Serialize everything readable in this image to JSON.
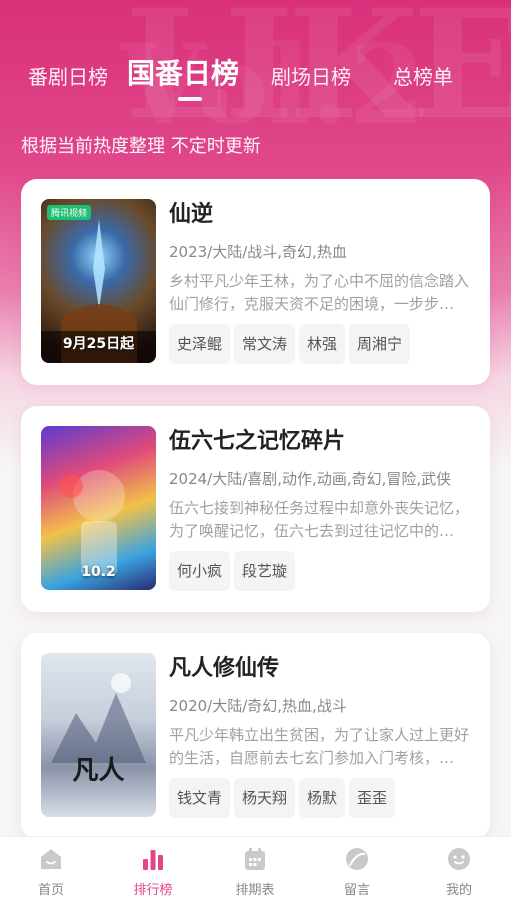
{
  "tabs": [
    {
      "label": "番剧日榜"
    },
    {
      "label": "国番日榜"
    },
    {
      "label": "剧场日榜"
    },
    {
      "label": "总榜单"
    }
  ],
  "active_tab": 1,
  "subtitle": "根据当前热度整理 不定时更新",
  "accent_color": "#e0478a",
  "cards": [
    {
      "title": "仙逆",
      "meta": "2023/大陆/战斗,奇幻,热血",
      "description": "乡村平凡少年王林，为了心中不屈的信念踏入仙门修行，克服天资不足的困境，一步步走向巅峰。",
      "tags": [
        "史泽鲲",
        "常文涛",
        "林强",
        "周湘宁"
      ],
      "poster": {
        "badge": "腾讯视频",
        "text": "9月25日起"
      }
    },
    {
      "title": "伍六七之记忆碎片",
      "meta": "2024/大陆/喜剧,动作,动画,奇幻,冒险,武侠",
      "description": "伍六七接到神秘任务过程中却意外丧失记忆，为了唤醒记忆，伍六七去到过往记忆中的地方寻找线索。",
      "tags": [
        "何小疯",
        "段艺璇"
      ],
      "poster": {
        "badge": "",
        "text": "10.2"
      }
    },
    {
      "title": "凡人修仙传",
      "meta": "2020/大陆/奇幻,热血,战斗",
      "description": "平凡少年韩立出生贫困，为了让家人过上更好的生活，自愿前去七玄门参加入门考核，从此踏上修仙之路。",
      "tags": [
        "钱文青",
        "杨天翔",
        "杨默",
        "歪歪"
      ],
      "poster": {
        "badge": "",
        "text": "凡人"
      }
    }
  ],
  "nav": [
    {
      "label": "首页",
      "icon": "home-icon"
    },
    {
      "label": "排行榜",
      "icon": "ranking-icon"
    },
    {
      "label": "排期表",
      "icon": "calendar-icon"
    },
    {
      "label": "留言",
      "icon": "message-icon"
    },
    {
      "label": "我的",
      "icon": "profile-icon"
    }
  ]
}
